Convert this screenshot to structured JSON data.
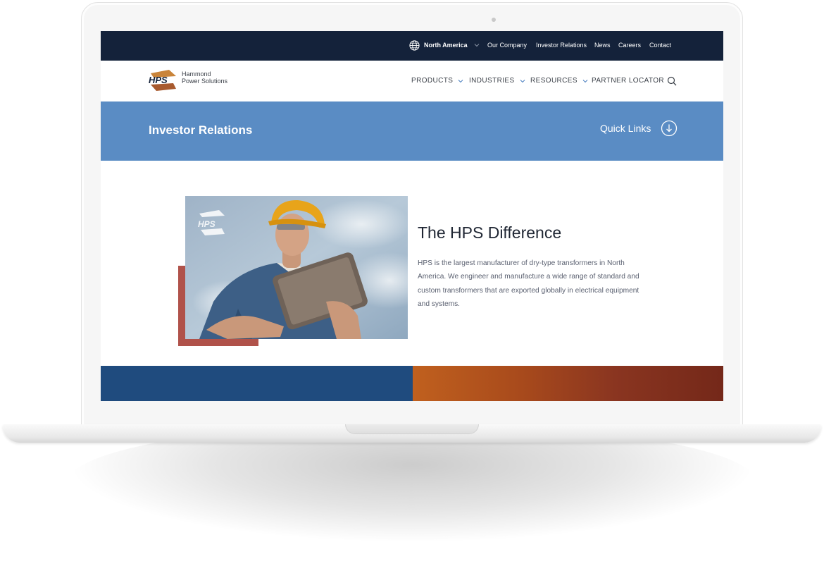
{
  "topbar": {
    "region_label": "North America",
    "links": [
      "Our Company",
      "Investor Relations",
      "News",
      "Careers",
      "Contact"
    ]
  },
  "logo": {
    "mark": "HPS",
    "line1": "Hammond",
    "line2": "Power Solutions"
  },
  "nav": {
    "items": [
      "PRODUCTS",
      "INDUSTRIES",
      "RESOURCES",
      "PARTNER LOCATOR"
    ]
  },
  "banner": {
    "title": "Investor Relations",
    "quick_links_label": "Quick Links"
  },
  "difference": {
    "title": "The HPS Difference",
    "body": "HPS is the largest manufacturer of dry-type transformers in North America. We engineer and manufacture a wide range of standard and custom transformers that are exported globally in electrical equipment and systems."
  },
  "photo": {
    "watermark": "HPS"
  },
  "icons": {
    "globe": "globe-icon",
    "chevron": "chevron-down-icon",
    "search": "search-icon",
    "quick_links": "arrow-down-circle-icon"
  },
  "colors": {
    "topbar": "#14223a",
    "banner": "#5a8cc4",
    "accent": "#b0524a",
    "band_blue": "#1f4b7e",
    "band_orange": "#c0601e"
  }
}
